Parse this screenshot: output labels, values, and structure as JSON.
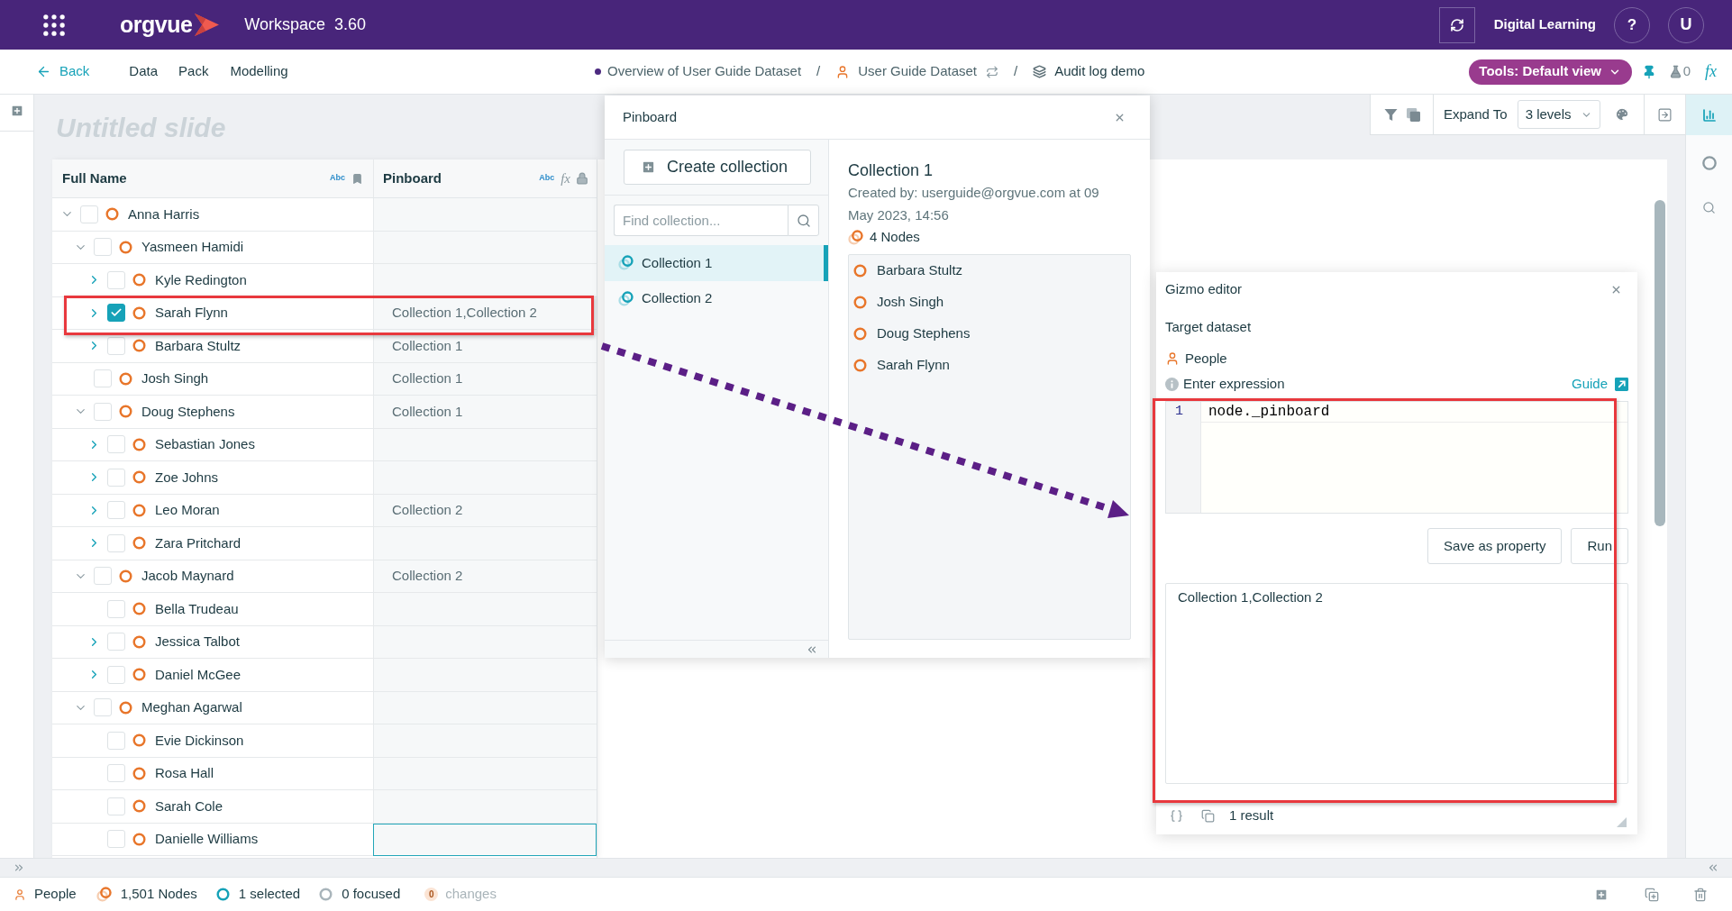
{
  "header": {
    "logo": "orgvue",
    "workspace": "Workspace",
    "version": "3.60",
    "account": "Digital Learning",
    "help": "?",
    "avatar": "U"
  },
  "nav": {
    "back": "Back",
    "menu": [
      "Data",
      "Pack",
      "Modelling"
    ],
    "breadcrumbs": [
      {
        "kind": "view",
        "label": "Overview of User Guide Dataset"
      },
      {
        "kind": "separator",
        "label": "/"
      },
      {
        "kind": "dataset",
        "label": "User Guide Dataset"
      },
      {
        "kind": "separator",
        "label": "/"
      },
      {
        "kind": "layer",
        "label": "Audit log demo"
      }
    ],
    "tools_button": "Tools: Default view",
    "lab_count": "0",
    "formula": "fx"
  },
  "slide": {
    "title": "Untitled slide"
  },
  "toolbar": {
    "expand_label": "Expand To",
    "levels": "3 levels"
  },
  "table": {
    "columns": [
      {
        "label": "Full Name",
        "type_tag": "Abc",
        "kind": "bookmarked"
      },
      {
        "label": "Pinboard",
        "type_tag": "Abc",
        "formula": "fx",
        "kind": "locked"
      }
    ],
    "rows": [
      {
        "name": "Anna Harris",
        "kind": "branch",
        "expanded": true,
        "checked": false,
        "focused": false,
        "children": [
          {
            "name": "Yasmeen Hamidi",
            "kind": "branch",
            "expanded": true,
            "checked": false,
            "focused": false,
            "children": [
              {
                "name": "Kyle Redington",
                "kind": "branch",
                "expanded": false,
                "checked": false,
                "focused": false
              },
              {
                "name": "Sarah Flynn",
                "kind": "branch",
                "expanded": false,
                "checked": true,
                "focused": false,
                "pinboard": "Collection 1,Collection 2"
              },
              {
                "name": "Barbara Stultz",
                "kind": "branch",
                "expanded": false,
                "checked": false,
                "focused": false,
                "pinboard": "Collection 1"
              }
            ]
          },
          {
            "name": "Josh Singh",
            "kind": "leaf",
            "checked": false,
            "focused": false,
            "pinboard": "Collection 1"
          },
          {
            "name": "Doug Stephens",
            "kind": "branch",
            "expanded": true,
            "checked": false,
            "focused": false,
            "pinboard": "Collection 1",
            "children": [
              {
                "name": "Sebastian Jones",
                "kind": "branch",
                "expanded": false,
                "checked": false,
                "focused": false
              },
              {
                "name": "Zoe Johns",
                "kind": "branch",
                "expanded": false,
                "checked": false,
                "focused": false
              },
              {
                "name": "Leo Moran",
                "kind": "branch",
                "expanded": false,
                "checked": false,
                "focused": false,
                "pinboard": "Collection 2"
              },
              {
                "name": "Zara Pritchard",
                "kind": "branch",
                "expanded": false,
                "checked": false,
                "focused": false
              }
            ]
          },
          {
            "name": "Jacob Maynard",
            "kind": "branch",
            "expanded": true,
            "checked": false,
            "focused": false,
            "pinboard": "Collection 2",
            "children": [
              {
                "name": "Bella Trudeau",
                "kind": "leaf",
                "checked": false,
                "focused": false
              },
              {
                "name": "Jessica Talbot",
                "kind": "branch",
                "expanded": false,
                "checked": false,
                "focused": false
              },
              {
                "name": "Daniel McGee",
                "kind": "branch",
                "expanded": false,
                "checked": false,
                "focused": false
              }
            ]
          },
          {
            "name": "Meghan Agarwal",
            "kind": "branch",
            "expanded": true,
            "checked": false,
            "focused": false,
            "children": [
              {
                "name": "Evie Dickinson",
                "kind": "leaf",
                "checked": false,
                "focused": false
              },
              {
                "name": "Rosa Hall",
                "kind": "leaf",
                "checked": false,
                "focused": false
              },
              {
                "name": "Sarah Cole",
                "kind": "leaf",
                "checked": false,
                "focused": false
              },
              {
                "name": "Danielle Williams",
                "kind": "leaf",
                "checked": false,
                "focused": true
              }
            ]
          }
        ]
      }
    ]
  },
  "pinboard": {
    "title": "Pinboard",
    "create_button": "Create collection",
    "search": {
      "placeholder": "Find collection..."
    },
    "collections": [
      {
        "label": "Collection 1",
        "selected": true
      },
      {
        "label": "Collection 2",
        "selected": false
      }
    ],
    "detail": {
      "title": "Collection 1",
      "created_by": "Created by: userguide@orgvue.com at 09 May 2023, 14:56",
      "node_count": "4 Nodes",
      "nodes": [
        "Barbara Stultz",
        "Josh Singh",
        "Doug Stephens",
        "Sarah Flynn"
      ]
    }
  },
  "gizmo_editor": {
    "title": "Gizmo editor",
    "target_label": "Target dataset",
    "dataset": "People",
    "expression_label": "Enter expression",
    "guide_link": "Guide",
    "code": [
      {
        "line": "1",
        "text": "node._pinboard"
      }
    ],
    "buttons": [
      "Save as property",
      "Run"
    ],
    "result": "Collection 1,Collection 2",
    "result_count": "1 result"
  },
  "status_bar": {
    "dataset": "People",
    "nodes": "1,501 Nodes",
    "selected": "1 selected",
    "focused": "0 focused",
    "changes": {
      "count": "0",
      "label": "changes",
      "disabled": true
    }
  }
}
